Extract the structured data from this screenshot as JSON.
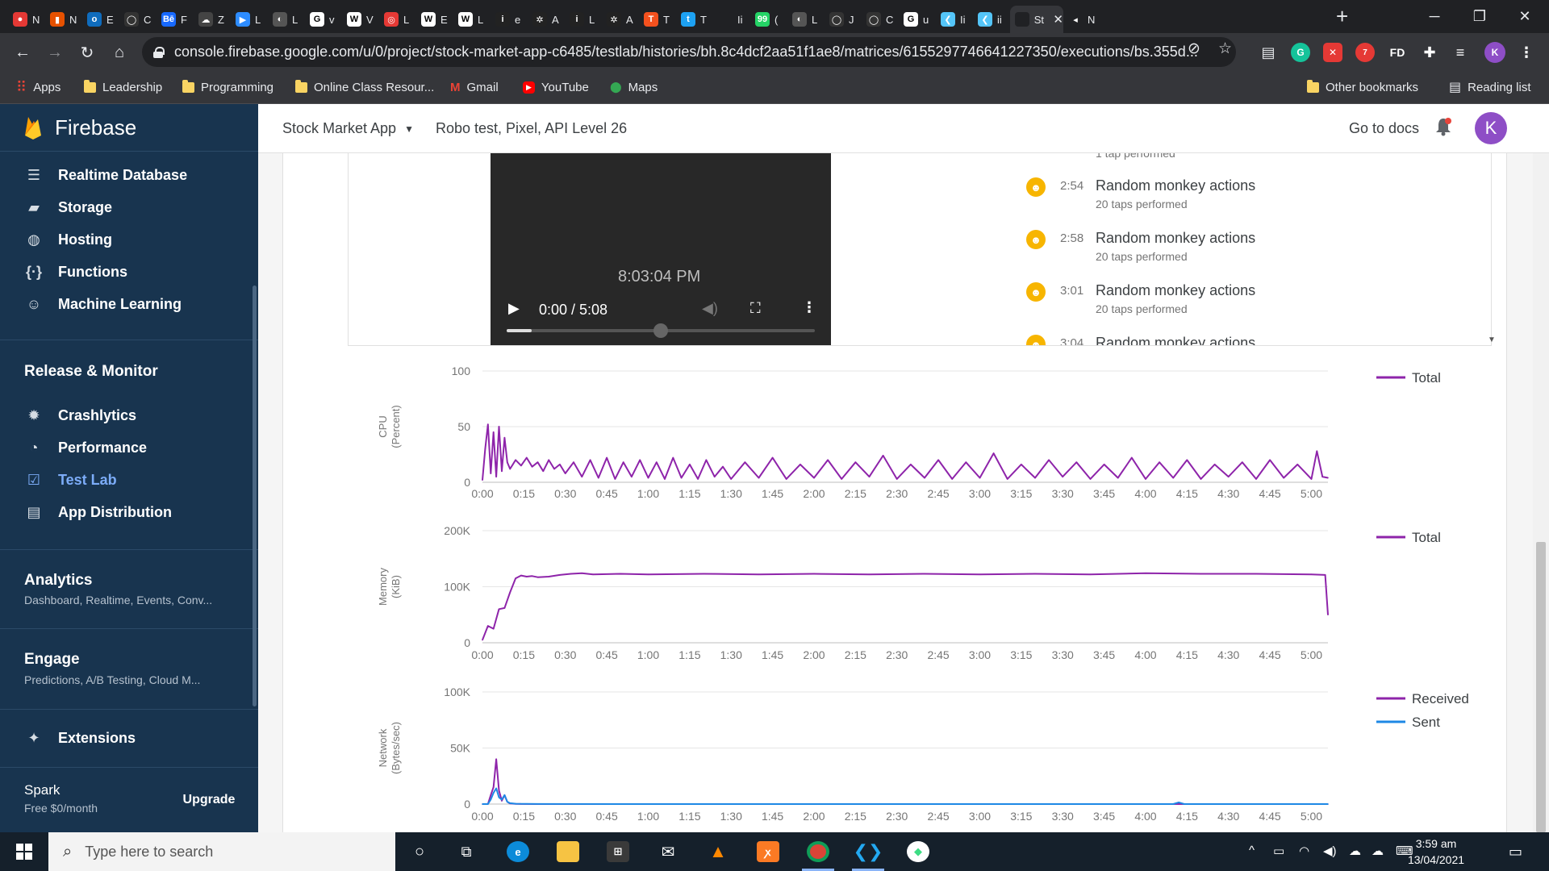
{
  "browser": {
    "tabs": [
      {
        "title": "N",
        "color": "#e53935",
        "glyph": "●"
      },
      {
        "title": "N",
        "color": "#e65100",
        "glyph": "▮"
      },
      {
        "title": "E",
        "color": "#0f6cbd",
        "glyph": "o"
      },
      {
        "title": "C",
        "color": "#333333",
        "glyph": "◯"
      },
      {
        "title": "F",
        "color": "#1769ff",
        "glyph": "Bē"
      },
      {
        "title": "Z",
        "color": "#444444",
        "glyph": "☁"
      },
      {
        "title": "L",
        "color": "#2d8cff",
        "glyph": "▶"
      },
      {
        "title": "L",
        "color": "#555555",
        "glyph": "◐"
      },
      {
        "title": "v",
        "color": "#ffffff",
        "glyph": "G"
      },
      {
        "title": "V",
        "color": "#ffffff",
        "glyph": "W"
      },
      {
        "title": "L",
        "color": "#e53935",
        "glyph": "◎"
      },
      {
        "title": "E",
        "color": "#ffffff",
        "glyph": "W"
      },
      {
        "title": "L",
        "color": "#ffffff",
        "glyph": "W"
      },
      {
        "title": "e",
        "color": "#222222",
        "glyph": "i"
      },
      {
        "title": "A",
        "color": "#222222",
        "glyph": "✲"
      },
      {
        "title": "L",
        "color": "#222222",
        "glyph": "i"
      },
      {
        "title": "A",
        "color": "#222222",
        "glyph": "✲"
      },
      {
        "title": "T",
        "color": "#f4511e",
        "glyph": "T"
      },
      {
        "title": "T",
        "color": "#1da1f2",
        "glyph": "t"
      },
      {
        "title": "Ii",
        "color": "#202124",
        "glyph": ""
      },
      {
        "title": "(",
        "color": "#25d366",
        "glyph": "99"
      },
      {
        "title": "L",
        "color": "#555555",
        "glyph": "◐"
      },
      {
        "title": "J",
        "color": "#333333",
        "glyph": "◯"
      },
      {
        "title": "C",
        "color": "#333333",
        "glyph": "◯"
      },
      {
        "title": "u",
        "color": "#ffffff",
        "glyph": "G"
      },
      {
        "title": "Ii",
        "color": "#54c5f8",
        "glyph": "❮"
      },
      {
        "title": "ii",
        "color": "#54c5f8",
        "glyph": "❮"
      },
      {
        "title": "St",
        "color": "#202124",
        "glyph": "",
        "active": true
      },
      {
        "title": "N",
        "color": "#202124",
        "glyph": "◂"
      }
    ],
    "url": "console.firebase.google.com/u/0/project/stock-market-app-c6485/testlab/histories/bh.8c4dcf2aa51f1ae8/matrices/6155297746641227350/executions/bs.355d...",
    "bookmarks": [
      {
        "label": "Apps",
        "kind": "apps"
      },
      {
        "label": "Leadership",
        "kind": "folder"
      },
      {
        "label": "Programming",
        "kind": "folder"
      },
      {
        "label": "Online Class Resour...",
        "kind": "folder"
      },
      {
        "label": "Gmail",
        "kind": "gmail"
      },
      {
        "label": "YouTube",
        "kind": "youtube"
      },
      {
        "label": "Maps",
        "kind": "maps"
      }
    ],
    "other_bookmarks": "Other bookmarks",
    "reading_list": "Reading list",
    "profile_initial": "K",
    "ext_badge": "7",
    "ext_fd": "FD"
  },
  "sidebar": {
    "brand": "Firebase",
    "build_items": [
      {
        "label": "Realtime Database",
        "icon": "database-icon",
        "glyph": "☰"
      },
      {
        "label": "Storage",
        "icon": "storage-icon",
        "glyph": "▰"
      },
      {
        "label": "Hosting",
        "icon": "hosting-icon",
        "glyph": "◍"
      },
      {
        "label": "Functions",
        "icon": "functions-icon",
        "glyph": "{·}"
      },
      {
        "label": "Machine Learning",
        "icon": "ml-icon",
        "glyph": "☺"
      }
    ],
    "release_heading": "Release & Monitor",
    "release_items": [
      {
        "label": "Crashlytics",
        "icon": "crashlytics-icon",
        "glyph": "✹"
      },
      {
        "label": "Performance",
        "icon": "performance-icon",
        "glyph": "◔"
      },
      {
        "label": "Test Lab",
        "icon": "test-lab-icon",
        "glyph": "☑",
        "active": true
      },
      {
        "label": "App Distribution",
        "icon": "app-distribution-icon",
        "glyph": "▤"
      }
    ],
    "analytics_heading": "Analytics",
    "analytics_sub": "Dashboard, Realtime, Events, Conv...",
    "engage_heading": "Engage",
    "engage_sub": "Predictions, A/B Testing, Cloud M...",
    "extensions_label": "Extensions",
    "plan_name": "Spark",
    "plan_price": "Free $0/month",
    "upgrade_label": "Upgrade"
  },
  "header": {
    "project": "Stock Market App",
    "breadcrumb": "Robo test, Pixel, API Level 26",
    "docs_link": "Go to docs",
    "avatar_initial": "K"
  },
  "video": {
    "overlay_time": "8:03:04 PM",
    "current": "0:00 / 5:08",
    "progress": 0.08
  },
  "actions": {
    "partial_top": "1 tap performed",
    "items": [
      {
        "time": "2:54",
        "name": "Random monkey actions",
        "detail": "20 taps performed"
      },
      {
        "time": "2:58",
        "name": "Random monkey actions",
        "detail": "20 taps performed"
      },
      {
        "time": "3:01",
        "name": "Random monkey actions",
        "detail": "20 taps performed"
      },
      {
        "time": "3:04",
        "name": "Random monkey actions",
        "detail": ""
      }
    ]
  },
  "chart_data": [
    {
      "type": "line",
      "ylabel": "CPU\n(Percent)",
      "yticks": [
        "100",
        "50",
        "0"
      ],
      "ylim": [
        0,
        100
      ],
      "xticks": [
        "0:00",
        "0:15",
        "0:30",
        "0:45",
        "1:00",
        "1:15",
        "1:30",
        "1:45",
        "2:00",
        "2:15",
        "2:30",
        "2:45",
        "3:00",
        "3:15",
        "3:30",
        "3:45",
        "4:00",
        "4:15",
        "4:30",
        "4:45",
        "5:00"
      ],
      "xlim_seconds": [
        0,
        306
      ],
      "series": [
        {
          "name": "Total",
          "color": "#8e24aa",
          "x": [
            0,
            1,
            2,
            3,
            4,
            5,
            6,
            7,
            8,
            9,
            10,
            12,
            14,
            16,
            18,
            20,
            22,
            24,
            26,
            28,
            30,
            33,
            36,
            39,
            42,
            45,
            48,
            51,
            54,
            57,
            60,
            63,
            66,
            69,
            72,
            75,
            78,
            81,
            84,
            87,
            90,
            95,
            100,
            105,
            110,
            115,
            120,
            125,
            130,
            135,
            140,
            145,
            150,
            155,
            160,
            165,
            170,
            175,
            180,
            185,
            190,
            195,
            200,
            205,
            210,
            215,
            220,
            225,
            230,
            235,
            240,
            245,
            250,
            255,
            260,
            265,
            270,
            275,
            280,
            285,
            290,
            295,
            300,
            302,
            304,
            306
          ],
          "y": [
            2,
            30,
            52,
            8,
            45,
            5,
            50,
            10,
            40,
            18,
            12,
            20,
            15,
            22,
            14,
            18,
            10,
            20,
            12,
            16,
            8,
            18,
            5,
            20,
            4,
            22,
            3,
            18,
            5,
            20,
            4,
            18,
            3,
            22,
            4,
            16,
            3,
            20,
            5,
            14,
            3,
            18,
            4,
            22,
            3,
            16,
            4,
            20,
            3,
            18,
            5,
            24,
            3,
            16,
            4,
            20,
            3,
            18,
            4,
            26,
            3,
            16,
            4,
            20,
            5,
            18,
            3,
            16,
            4,
            22,
            3,
            18,
            4,
            20,
            3,
            16,
            5,
            18,
            3,
            20,
            4,
            16,
            3,
            28,
            5,
            4
          ]
        }
      ],
      "legend": [
        "Total"
      ]
    },
    {
      "type": "line",
      "ylabel": "Memory\n(KiB)",
      "yticks": [
        "200K",
        "100K",
        "0"
      ],
      "ylim": [
        0,
        200000
      ],
      "xticks": [
        "0:00",
        "0:15",
        "0:30",
        "0:45",
        "1:00",
        "1:15",
        "1:30",
        "1:45",
        "2:00",
        "2:15",
        "2:30",
        "2:45",
        "3:00",
        "3:15",
        "3:30",
        "3:45",
        "4:00",
        "4:15",
        "4:30",
        "4:45",
        "5:00"
      ],
      "xlim_seconds": [
        0,
        306
      ],
      "series": [
        {
          "name": "Total",
          "color": "#8e24aa",
          "x": [
            0,
            2,
            4,
            6,
            8,
            10,
            12,
            14,
            16,
            18,
            20,
            24,
            28,
            32,
            36,
            40,
            50,
            60,
            80,
            100,
            120,
            140,
            160,
            180,
            200,
            220,
            240,
            260,
            280,
            300,
            305,
            306
          ],
          "y": [
            5000,
            30000,
            25000,
            60000,
            62000,
            90000,
            115000,
            120000,
            118000,
            119000,
            117000,
            118000,
            121000,
            123000,
            124000,
            122000,
            123000,
            122000,
            123000,
            122000,
            123000,
            122000,
            123000,
            122000,
            123000,
            122000,
            124000,
            123000,
            123000,
            122000,
            121000,
            50000
          ]
        }
      ],
      "legend": [
        "Total"
      ]
    },
    {
      "type": "line",
      "ylabel": "Network\n(Bytes/sec)",
      "yticks": [
        "100K",
        "50K",
        "0"
      ],
      "ylim": [
        0,
        100000
      ],
      "xticks": [
        "0:00",
        "0:15",
        "0:30",
        "0:45",
        "1:00",
        "1:15",
        "1:30",
        "1:45",
        "2:00",
        "2:15",
        "2:30",
        "2:45",
        "3:00",
        "3:15",
        "3:30",
        "3:45",
        "4:00",
        "4:15",
        "4:30",
        "4:45",
        "5:00"
      ],
      "xlim_seconds": [
        0,
        306
      ],
      "series": [
        {
          "name": "Received",
          "color": "#8e24aa",
          "x": [
            0,
            2,
            3,
            4,
            5,
            6,
            7,
            8,
            9,
            10,
            12,
            14,
            20,
            60,
            120,
            180,
            240,
            300,
            306
          ],
          "y": [
            0,
            0,
            8000,
            15000,
            40000,
            12000,
            3000,
            8000,
            2000,
            500,
            200,
            100,
            0,
            0,
            0,
            0,
            0,
            0,
            0
          ]
        },
        {
          "name": "Sent",
          "color": "#1e88e5",
          "x": [
            0,
            2,
            3,
            4,
            5,
            6,
            7,
            8,
            9,
            10,
            12,
            20,
            60,
            120,
            180,
            250,
            252,
            254,
            300,
            306
          ],
          "y": [
            0,
            0,
            4000,
            10000,
            14000,
            6000,
            4000,
            8000,
            2000,
            800,
            300,
            100,
            0,
            0,
            0,
            0,
            1500,
            0,
            0,
            0
          ]
        }
      ],
      "legend": [
        "Received",
        "Sent"
      ]
    }
  ],
  "taskbar": {
    "search_placeholder": "Type here to search",
    "time": "3:59 am",
    "date": "13/04/2021"
  }
}
